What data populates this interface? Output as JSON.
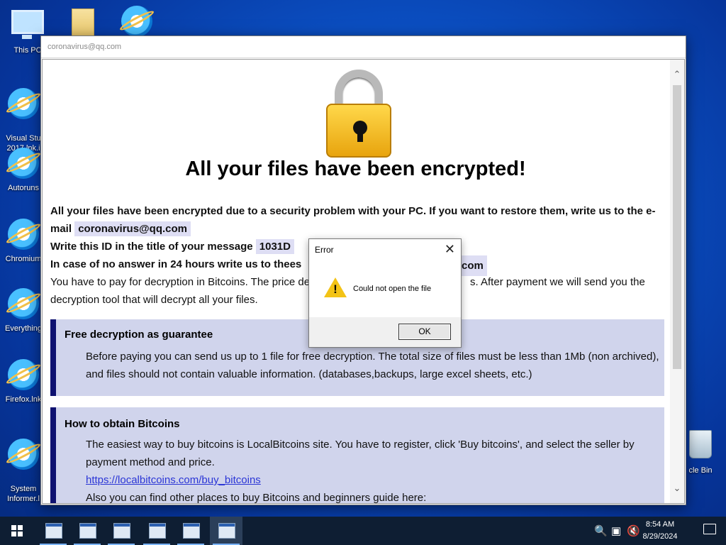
{
  "desktop": {
    "icons": [
      {
        "label": "This PC"
      },
      {
        "label": ""
      },
      {
        "label": ""
      },
      {
        "label": "Visual Stu\n2017.lnk.i"
      },
      {
        "label": "Autoruns"
      },
      {
        "label": "Chromium"
      },
      {
        "label": "Everything"
      },
      {
        "label": "Firefox.lnk"
      },
      {
        "label": "System\nInformer.l"
      },
      {
        "label": "cle Bin"
      }
    ]
  },
  "ransom_window": {
    "title": "coronavirus@qq.com",
    "headline": "All your files have been encrypted!",
    "p1_text": "All your files have been encrypted due to a security problem with your PC. If you want to restore them, write us to the e-mail",
    "p1_email": "coronavirus@qq.com",
    "p2_text": "Write this ID in the title of your message",
    "p2_id": "1031D",
    "p3_text": "In case of no answer in 24 hours write us to thees",
    "p3_email_tail": "com",
    "p4_start": "You have to pay for decryption in Bitcoins. The price de",
    "p4_end": "s. After payment we will send you the",
    "p4_line2": "decryption tool that will decrypt all your files.",
    "section1_title": "Free decryption as guarantee",
    "section1_text": "Before paying you can send us up to 1 file for free decryption. The total size of files must be less than 1Mb (non archived), and files should not contain valuable information. (databases,backups, large excel sheets, etc.)",
    "section2_title": "How to obtain Bitcoins",
    "section2_text": "The easiest way to buy bitcoins is LocalBitcoins site. You have to register, click 'Buy bitcoins', and select the seller by payment method and price.",
    "section2_link": "https://localbitcoins.com/buy_bitcoins",
    "section2_more": "Also you can find other places to buy Bitcoins and beginners guide here:"
  },
  "error_dialog": {
    "title": "Error",
    "message": "Could not open the file",
    "ok_label": "OK"
  },
  "taskbar": {
    "time": "8:54 AM",
    "date": "8/29/2024"
  },
  "colors": {
    "section_bar": "#0f1270",
    "section_bg": "#d0d4ec",
    "link": "#2a35d6"
  }
}
